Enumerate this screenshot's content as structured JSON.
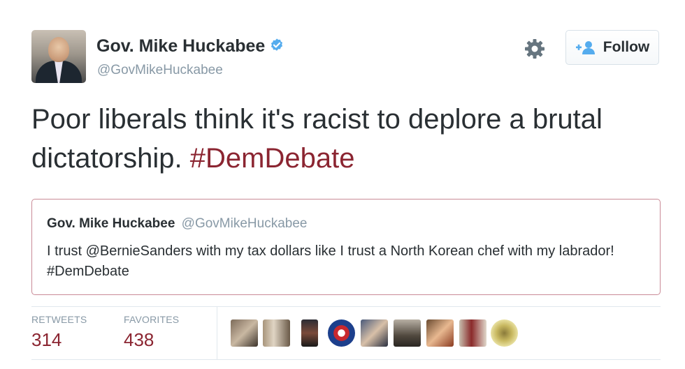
{
  "author": {
    "name": "Gov. Mike Huckabee",
    "handle": "@GovMikeHuckabee",
    "verified_icon": "verified-badge-icon"
  },
  "actions": {
    "settings_icon": "gear-icon",
    "follow_label": "Follow",
    "follow_icon": "add-user-icon"
  },
  "tweet": {
    "text": "Poor liberals think it's racist to deplore a brutal dictatorship. ",
    "hashtag": "#DemDebate"
  },
  "quoted_tweet": {
    "name": "Gov. Mike Huckabee",
    "handle": "@GovMikeHuckabee",
    "text": "I trust @BernieSanders with my tax dollars like I trust a North Korean chef with my labrador! #DemDebate"
  },
  "stats": {
    "retweets_label": "RETWEETS",
    "retweets_count": "314",
    "favorites_label": "FAVORITES",
    "favorites_count": "438"
  },
  "favoriters": [
    "avatar-1",
    "avatar-2",
    "avatar-3",
    "avatar-4",
    "avatar-5",
    "avatar-6",
    "avatar-7",
    "avatar-8",
    "avatar-9"
  ],
  "colors": {
    "hashtag": "#8b2531",
    "stat_value": "#8b2531",
    "muted": "#8899a6",
    "quote_border": "#c98a96",
    "verified": "#55acee"
  }
}
